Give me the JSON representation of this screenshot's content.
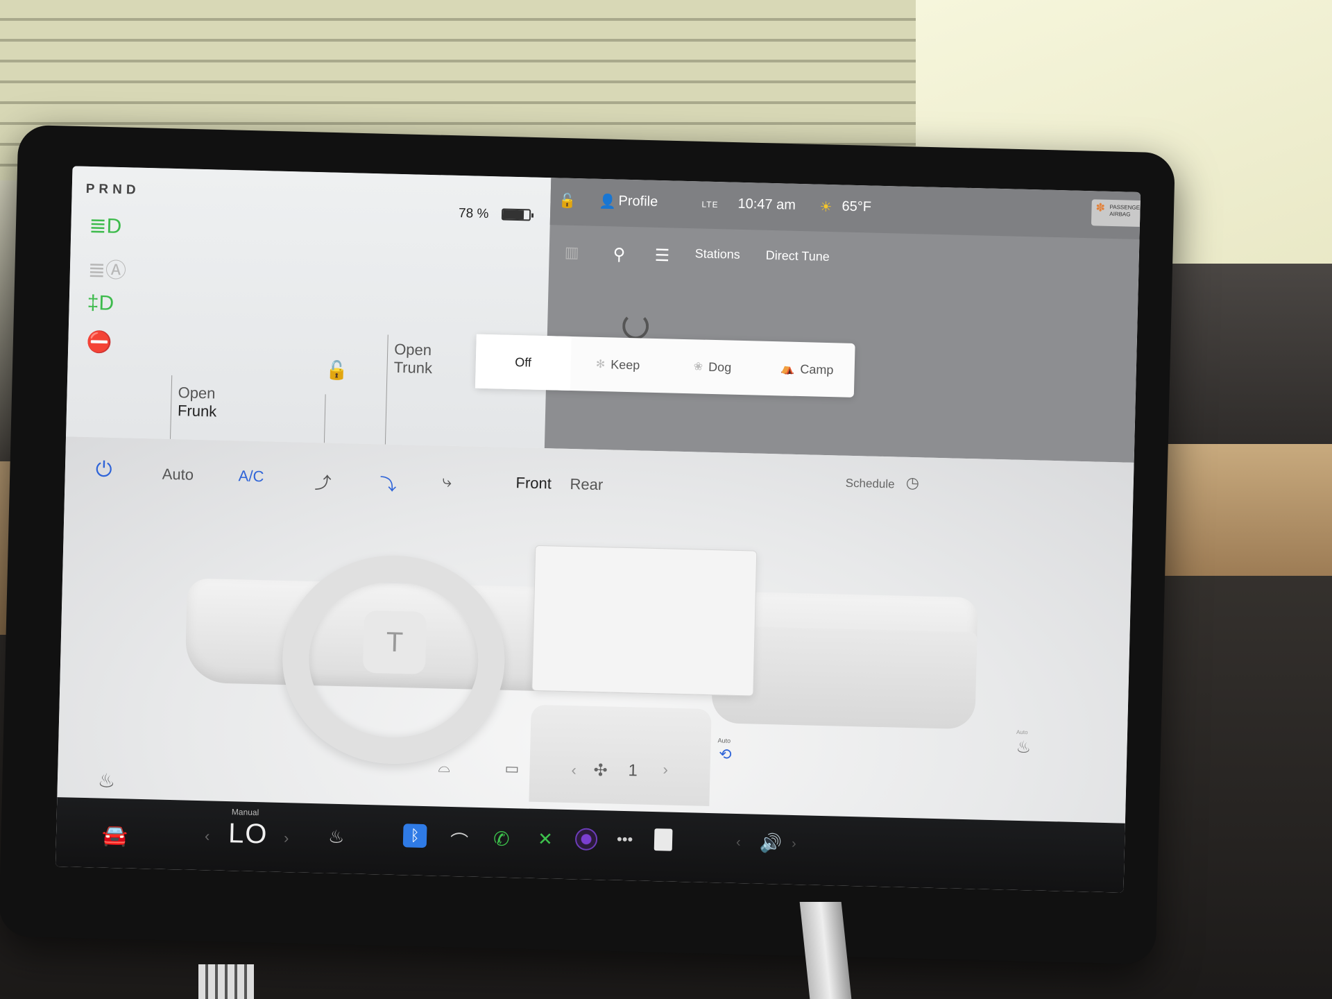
{
  "gear": "PRND",
  "battery": {
    "percent_label": "78 %",
    "level": 0.78
  },
  "status": {
    "profile_label": "Profile",
    "network": "LTE",
    "time": "10:47 am",
    "temperature": "65°F",
    "airbag_line1": "PASSENGER",
    "airbag_line2": "AIRBAG"
  },
  "doors": {
    "frunk_open": "Open",
    "frunk_name": "Frunk",
    "trunk_open": "Open",
    "trunk_name": "Trunk"
  },
  "media": {
    "tab_stations": "Stations",
    "tab_direct_tune": "Direct Tune"
  },
  "climate_modes": [
    {
      "label": "Off",
      "active": true
    },
    {
      "label": "Keep",
      "active": false
    },
    {
      "label": "Dog",
      "active": false
    },
    {
      "label": "Camp",
      "active": false
    }
  ],
  "climate": {
    "auto_label": "Auto",
    "ac_label": "A/C",
    "front_label": "Front",
    "rear_label": "Rear",
    "schedule_label": "Schedule",
    "fan_level": "1",
    "recirc_auto_label": "Auto",
    "seat_auto_label": "Auto"
  },
  "bottom_bar": {
    "temp_mode": "Manual",
    "temp_value": "LO"
  },
  "icons": {
    "headlight_low": "headlight-low-icon",
    "headlight_auto": "headlight-auto-icon",
    "fog": "fog-light-icon",
    "seatbelt": "seatbelt-warning-icon",
    "accent_blue": "#2f64d8",
    "indicator_green": "#3dbb4c",
    "warning_red": "#d8323c"
  }
}
